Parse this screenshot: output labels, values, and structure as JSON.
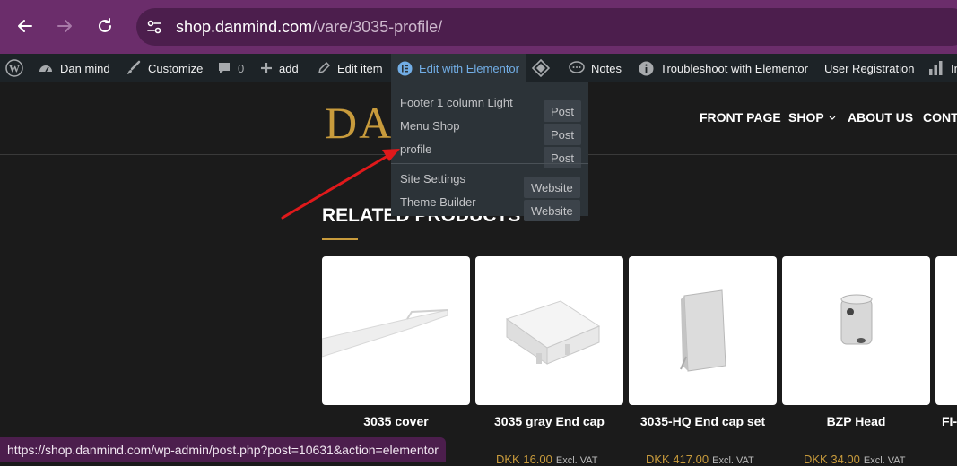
{
  "browser": {
    "url_host": "shop.danmind.com",
    "url_path": "/vare/3035-profile/"
  },
  "admin_bar": {
    "site_name": "Dan mind",
    "customize": "Customize",
    "comments_count": "0",
    "add": "add",
    "edit_item": "Edit item",
    "edit_elementor": "Edit with Elementor",
    "notes": "Notes",
    "troubleshoot": "Troubleshoot with Elementor",
    "user_registration": "User Registration",
    "last_partial": "In"
  },
  "elementor_menu": {
    "items": [
      {
        "label": "Footer 1 column Light",
        "badge": "Post"
      },
      {
        "label": "Menu Shop",
        "badge": "Post"
      },
      {
        "label": "profile",
        "badge": "Post"
      },
      {
        "label": "Site Settings",
        "badge": "Website"
      },
      {
        "label": "Theme Builder",
        "badge": "Website"
      }
    ]
  },
  "site": {
    "logo_text": "DAN",
    "menu": [
      "FRONT PAGE",
      "SHOP",
      "ABOUT US",
      "CONTA"
    ],
    "section_title": "RELATED PRODUCTS"
  },
  "products": [
    {
      "name": "3035 cover",
      "price": "",
      "vat": ""
    },
    {
      "name": "3035 gray End cap",
      "price": "DKK 16.00",
      "vat": "Excl. VAT"
    },
    {
      "name": "3035-HQ End cap set",
      "price": "DKK 417.00",
      "vat": "Excl. VAT"
    },
    {
      "name": "BZP Head",
      "price": "DKK 34.00",
      "vat": "Excl. VAT"
    },
    {
      "name": "FI-",
      "price": "",
      "vat": ""
    }
  ],
  "status_bar": {
    "url": "https://shop.danmind.com/wp-admin/post.php?post=10631&action=elementor"
  },
  "colors": {
    "browser_chrome": "#6b2d6b",
    "admin_bar": "#1d2327",
    "accent_gold": "#c89b3c",
    "arrow": "#e0191b"
  }
}
